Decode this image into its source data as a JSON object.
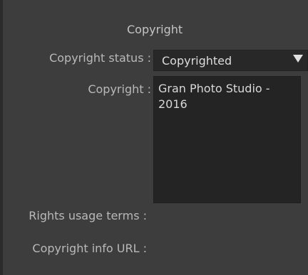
{
  "section": {
    "title": "Copyright"
  },
  "fields": {
    "status_label": "Copyright status :",
    "status_value": "Copyrighted",
    "copyright_label": "Copyright :",
    "copyright_value": "Gran Photo Studio -\n2016",
    "rights_usage_label": "Rights usage terms :",
    "info_url_label": "Copyright info URL :"
  },
  "icons": {
    "dropdown": "triangle-down-icon"
  },
  "colors": {
    "panel_bg": "#3d3d3d",
    "field_bg": "#242424",
    "text": "#c8c8c8"
  }
}
